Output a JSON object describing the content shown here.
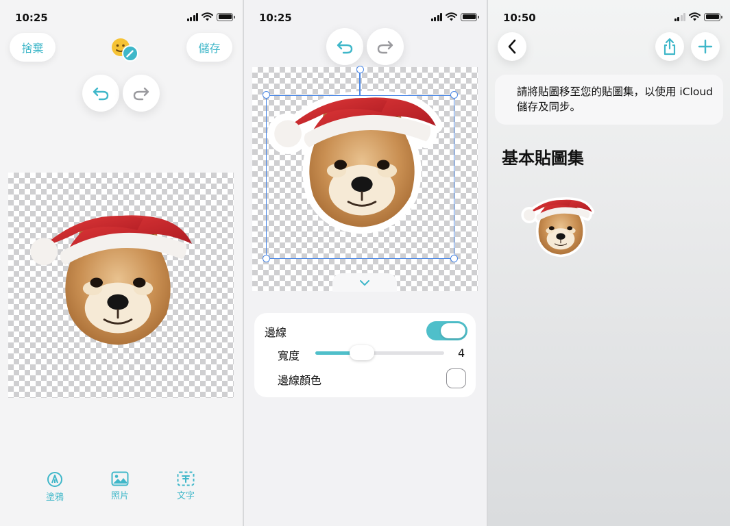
{
  "colors": {
    "accent": "#3fb7c9",
    "toggle_on": "#4fbfca",
    "selection": "#4a87e6"
  },
  "screen1": {
    "status": {
      "time": "10:25"
    },
    "header": {
      "discard_label": "捨棄",
      "save_label": "儲存",
      "sticker_edit_icon": "emoji-pencil-icon"
    },
    "history": {
      "undo_icon": "undo-arrow-icon",
      "redo_icon": "redo-arrow-icon"
    },
    "toolbar": [
      {
        "label": "塗鴉",
        "icon": "pen-tip-icon"
      },
      {
        "label": "照片",
        "icon": "photo-icon"
      },
      {
        "label": "文字",
        "icon": "text-box-icon"
      }
    ]
  },
  "screen2": {
    "status": {
      "time": "10:25"
    },
    "history": {
      "undo_icon": "undo-arrow-icon",
      "redo_icon": "redo-arrow-icon"
    },
    "border_panel": {
      "border_label": "邊線",
      "border_enabled": true,
      "width_label": "寬度",
      "width_value": "4",
      "width_fraction": 0.36,
      "color_label": "邊線顏色"
    }
  },
  "screen3": {
    "status": {
      "time": "10:50"
    },
    "nav": {
      "back_icon": "chevron-left-icon",
      "share_icon": "share-icon",
      "add_icon": "plus-icon"
    },
    "info_text": "請將貼圖移至您的貼圖集，以使用 iCloud 儲存及同步。",
    "section_title": "基本貼圖集"
  }
}
